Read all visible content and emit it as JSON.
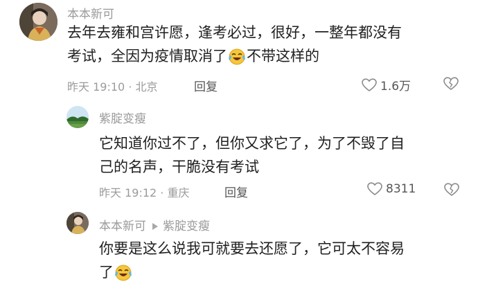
{
  "comment": {
    "username": "本本新可",
    "text_line1": "去年去雍和宫许愿，逢考必过，很好，一整年都没有",
    "text_line2_before_emoji": "考试，全因为疫情取消了",
    "text_line2_after_emoji": "不带这样的",
    "time_location": "昨天 19:10 · 北京",
    "reply_label": "回复",
    "likes": "1.6万"
  },
  "reply": {
    "username": "紫腚变瘦",
    "text_line1": "它知道你过不了，但你又求它了，为了不毁了自",
    "text_line2": "己的名声，干脆没有考试",
    "time_location": "昨天 19:12 · 重庆",
    "reply_label": "回复",
    "likes": "8311"
  },
  "subreply": {
    "username": "本本新可",
    "reply_to": "紫腚变瘦",
    "text_line1": "你要是这么说我可就要去还愿了，它可太不容易",
    "text_line2_before_emoji": "了"
  },
  "icons": {
    "like": "heart-outline-icon",
    "dislike": "broken-heart-icon",
    "emoji": "laughing-crying-emoji-icon",
    "reply_arrow": "triangle-right-icon"
  }
}
